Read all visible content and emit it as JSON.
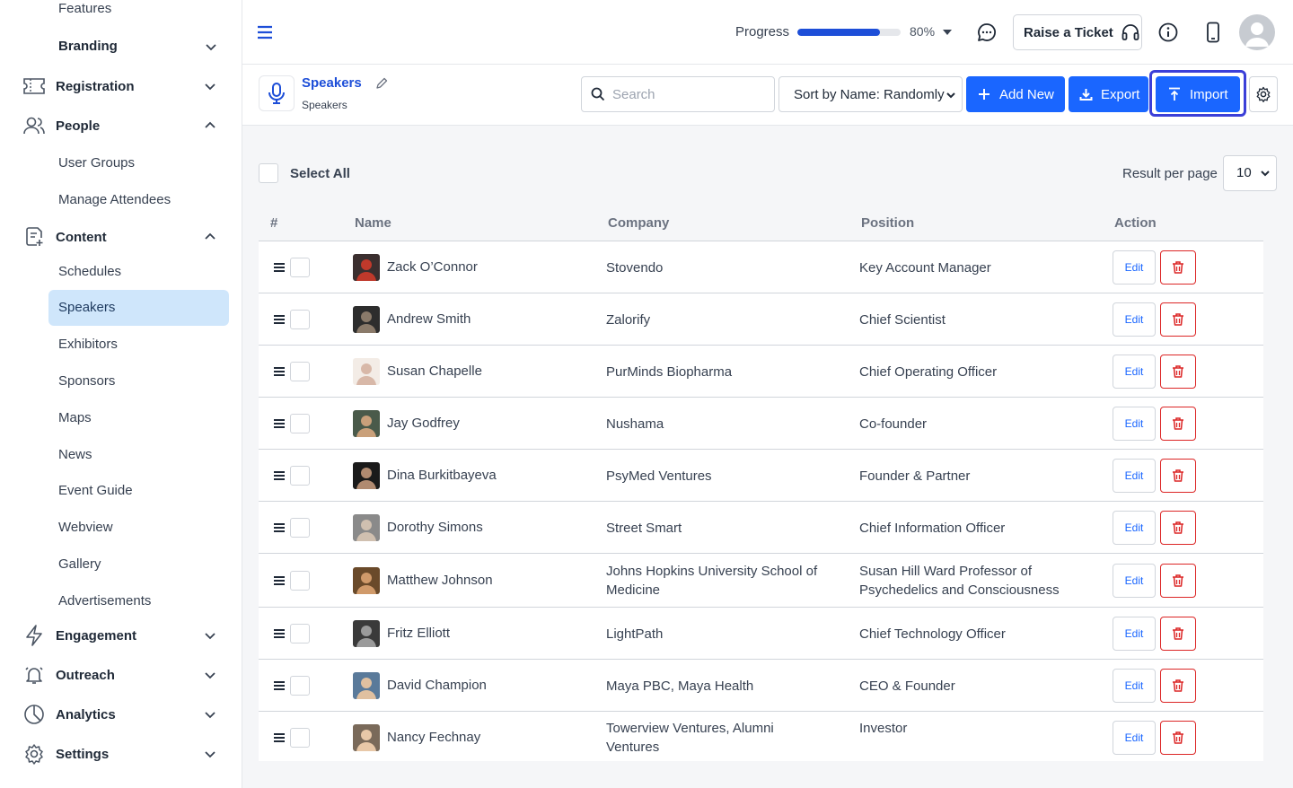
{
  "sidebar": {
    "features": "Features",
    "branding": "Branding",
    "registration": "Registration",
    "people": "People",
    "people_items": [
      "User Groups",
      "Manage Attendees"
    ],
    "content": "Content",
    "content_items": [
      "Schedules",
      "Speakers",
      "Exhibitors",
      "Sponsors",
      "Maps",
      "News",
      "Event Guide",
      "Webview",
      "Gallery",
      "Advertisements"
    ],
    "engagement": "Engagement",
    "outreach": "Outreach",
    "analytics": "Analytics",
    "settings": "Settings",
    "active_item": "Speakers"
  },
  "header": {
    "progress_label": "Progress",
    "progress_value": 0.8,
    "progress_text": "80%",
    "raise_ticket": "Raise a Ticket",
    "icons": [
      "menu-icon",
      "chat-icon",
      "headset-icon",
      "info-icon",
      "mobile-icon",
      "user-avatar-icon"
    ]
  },
  "page": {
    "title": "Speakers",
    "subtitle": "Speakers",
    "search_placeholder": "Search",
    "sort_value": "Sort by Name: Randomly",
    "add_new": "Add New",
    "export": "Export",
    "import": "Import"
  },
  "list": {
    "select_all": "Select All",
    "result_per_page_label": "Result per page",
    "result_per_page_value": "10",
    "columns": [
      "#",
      "Name",
      "Company",
      "Position",
      "Action"
    ],
    "edit_label": "Edit",
    "rows": [
      {
        "name": "Zack O’Connor",
        "company": "Stovendo",
        "position": "Key Account Manager"
      },
      {
        "name": "Andrew Smith",
        "company": "Zalorify",
        "position": "Chief Scientist"
      },
      {
        "name": "Susan Chapelle",
        "company": "PurMinds Biopharma",
        "position": "Chief Operating Officer"
      },
      {
        "name": "Jay Godfrey",
        "company": "Nushama",
        "position": "Co-founder"
      },
      {
        "name": "Dina Burkitbayeva",
        "company": "PsyMed Ventures",
        "position": "Founder & Partner"
      },
      {
        "name": "Dorothy Simons",
        "company": "Street Smart",
        "position": "Chief Information Officer"
      },
      {
        "name": "Matthew Johnson",
        "company": "Johns Hopkins University School of Medicine",
        "position": "Susan Hill Ward Professor of Psychedelics and Consciousness"
      },
      {
        "name": "Fritz Elliott",
        "company": "LightPath",
        "position": "Chief Technology Officer"
      },
      {
        "name": "David Champion",
        "company": "Maya PBC, Maya Health",
        "position": "CEO & Founder"
      },
      {
        "name": "Nancy Fechnay",
        "company": "Towerview Ventures, Alumni Ventures",
        "position": "Investor"
      }
    ]
  },
  "colors": {
    "accent": "#1a66ff",
    "title_blue": "#1d4ed8",
    "active_bg": "#cfe6fb",
    "danger": "#dc2626",
    "import_focus": "#3b3fd8"
  }
}
